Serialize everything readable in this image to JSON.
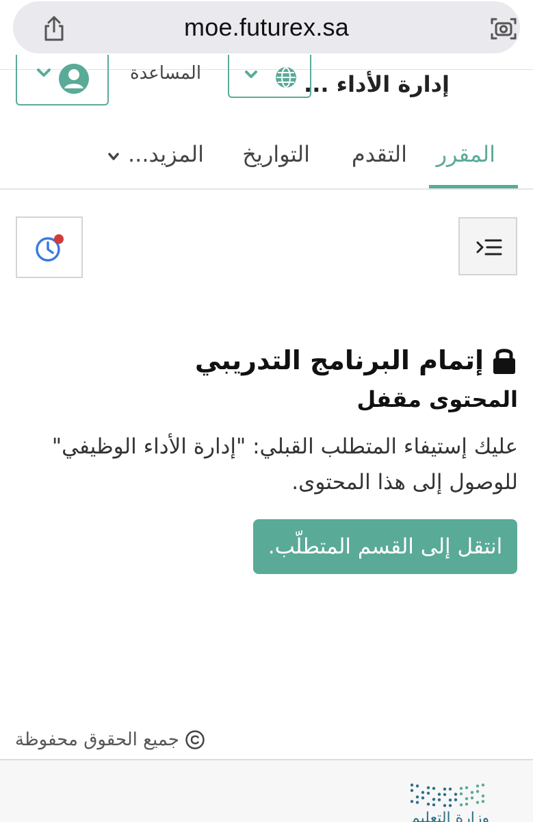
{
  "browser": {
    "url": "moe.futurex.sa",
    "share_icon": "share-icon",
    "lens_icon": "camera-search-icon"
  },
  "header": {
    "course_title": "إدارة الأداء ...",
    "help_label": "المساعدة",
    "account_icon": "user-avatar-icon",
    "language_icon": "globe-icon"
  },
  "tabs": [
    {
      "label": "المقرر",
      "active": true
    },
    {
      "label": "التقدم",
      "active": false
    },
    {
      "label": "التواريخ",
      "active": false
    },
    {
      "label": "المزيد...",
      "active": false
    }
  ],
  "toolbar": {
    "outline_icon": "course-outline-icon",
    "history_icon": "clock-notification-icon"
  },
  "locked": {
    "title": "إتمام البرنامج التدريبي",
    "subtitle": "المحتوى مقفل",
    "message": "عليك إستيفاء المتطلب القبلي: \"إدارة الأداء الوظيفي\" للوصول إلى هذا المحتوى.",
    "button_label": "انتقل إلى القسم المتطلّب.",
    "icon": "lock-icon"
  },
  "footer": {
    "copyright": "جميع الحقوق محفوظة",
    "copyright_icon": "copyright-icon",
    "logo_text": "وزارة التعليم"
  },
  "colors": {
    "accent": "#5aaa98",
    "notification_dot": "#d23b3b",
    "clock_blue": "#3b7be0"
  }
}
